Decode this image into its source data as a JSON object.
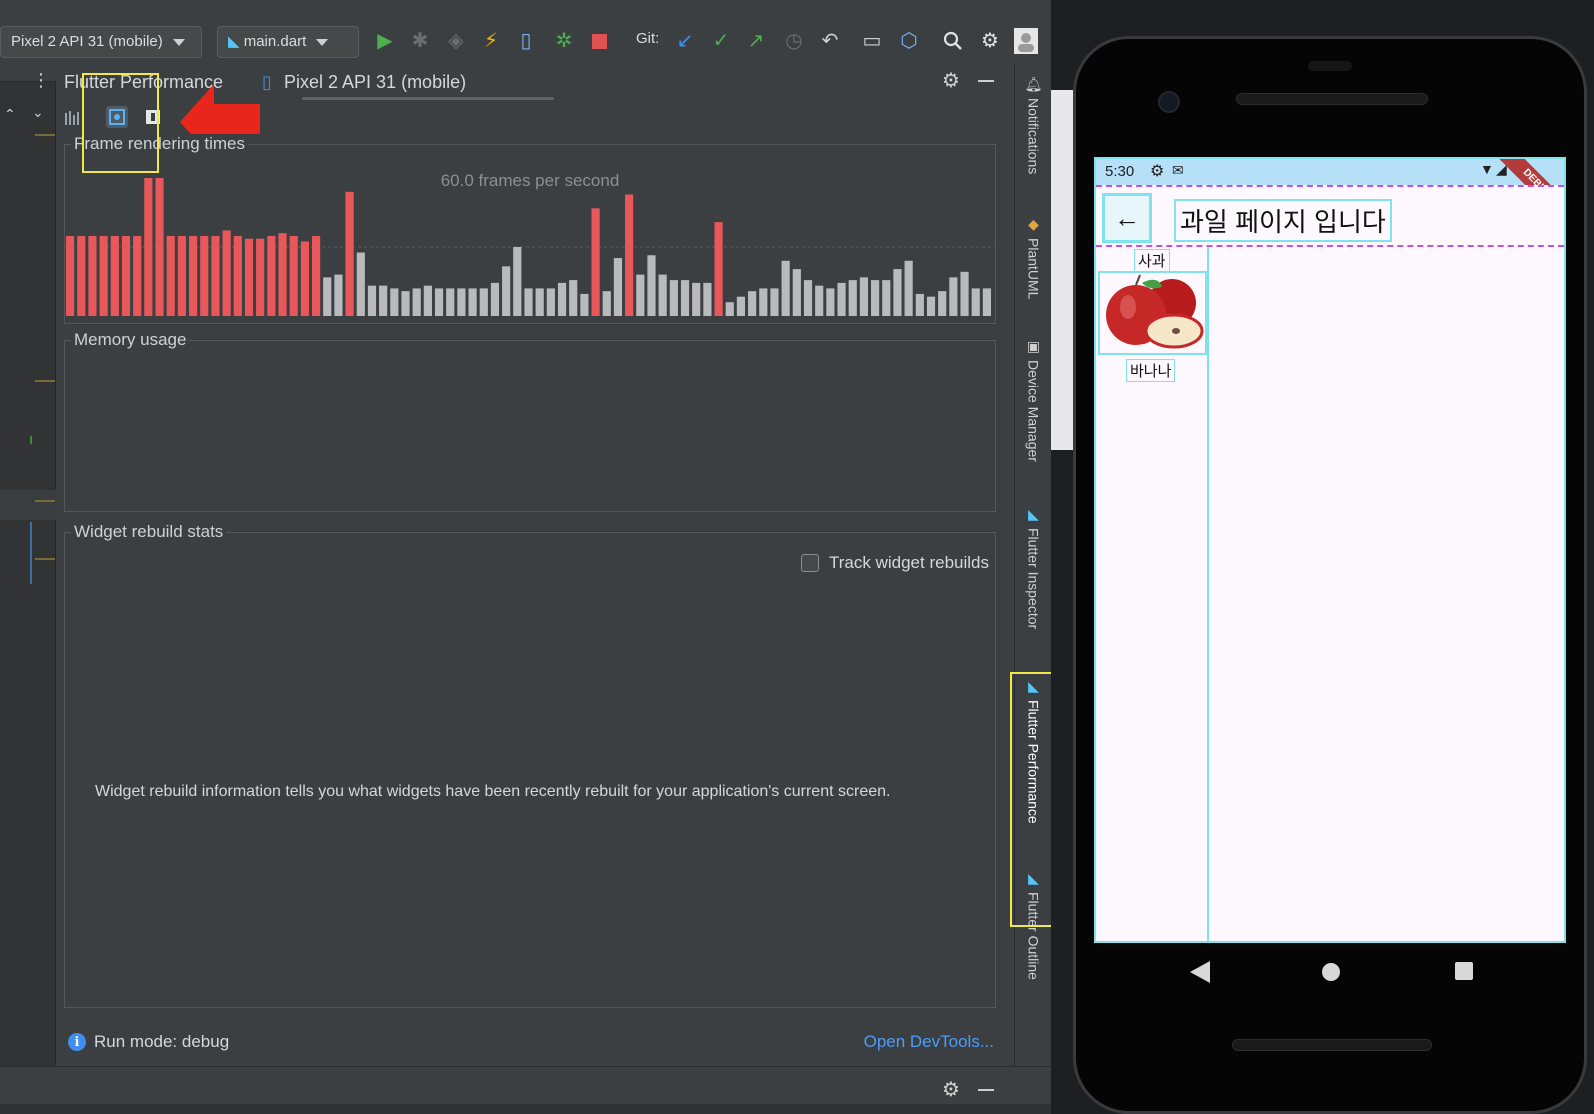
{
  "toolbar": {
    "device_selector": "Pixel 2 API 31 (mobile)",
    "run_config": "main.dart",
    "git_label": "Git:"
  },
  "tool_window": {
    "tabs": [
      {
        "label": "Flutter Performance"
      },
      {
        "label": "Pixel 2 API 31 (mobile)"
      }
    ]
  },
  "frame_rendering": {
    "title": "Frame rendering times",
    "fps_label": "60.0 frames per second",
    "chart_data": {
      "type": "bar",
      "title": "Frame rendering times",
      "subtitle": "60.0 frames per second",
      "series": [
        {
          "values": [
            0.58,
            0.58,
            0.58,
            0.58,
            0.58,
            0.58,
            0.58,
            1.0,
            1.0,
            0.58,
            0.58,
            0.58,
            0.58,
            0.58,
            0.62,
            0.58,
            0.56,
            0.56,
            0.58,
            0.6,
            0.58,
            0.54,
            0.58,
            0.28,
            0.3,
            0.9,
            0.46,
            0.22,
            0.22,
            0.2,
            0.18,
            0.2,
            0.22,
            0.2,
            0.2,
            0.2,
            0.2,
            0.2,
            0.24,
            0.36,
            0.5,
            0.2,
            0.2,
            0.2,
            0.24,
            0.26,
            0.16,
            0.78,
            0.18,
            0.42,
            0.88,
            0.3,
            0.44,
            0.3,
            0.26,
            0.26,
            0.24,
            0.24,
            0.68,
            0.1,
            0.14,
            0.18,
            0.2,
            0.2,
            0.4,
            0.34,
            0.26,
            0.22,
            0.2,
            0.24,
            0.26,
            0.28,
            0.26,
            0.26,
            0.34,
            0.4,
            0.16,
            0.14,
            0.18,
            0.28,
            0.32,
            0.2,
            0.2
          ],
          "janky": [
            true,
            true,
            true,
            true,
            true,
            true,
            true,
            true,
            true,
            true,
            true,
            true,
            true,
            true,
            true,
            true,
            true,
            true,
            true,
            true,
            true,
            true,
            true,
            false,
            false,
            true,
            false,
            false,
            false,
            false,
            false,
            false,
            false,
            false,
            false,
            false,
            false,
            false,
            false,
            false,
            false,
            false,
            false,
            false,
            false,
            false,
            false,
            true,
            false,
            false,
            true,
            false,
            false,
            false,
            false,
            false,
            false,
            false,
            true,
            false,
            false,
            false,
            false,
            false,
            false,
            false,
            false,
            false,
            false,
            false,
            false,
            false,
            false,
            false,
            false,
            false,
            false,
            false,
            false,
            false,
            false,
            false,
            false
          ]
        }
      ],
      "colors": {
        "janky": "#e8585a",
        "normal": "#b8babd"
      },
      "grid": false
    }
  },
  "memory_usage": {
    "title": "Memory usage"
  },
  "widget_rebuild": {
    "title": "Widget rebuild stats",
    "track_label": "Track widget rebuilds",
    "info": "Widget rebuild information tells you what widgets have been recently rebuilt for your application's current screen."
  },
  "status": {
    "run_mode": "Run mode: debug",
    "devtools_link": "Open DevTools..."
  },
  "side_strip": {
    "items": [
      {
        "label": "Notifications"
      },
      {
        "label": "PlantUML"
      },
      {
        "label": "Device Manager"
      },
      {
        "label": "Flutter Inspector"
      },
      {
        "label": "Flutter Performance"
      },
      {
        "label": "Flutter Outline"
      }
    ]
  },
  "emulator": {
    "time": "5:30",
    "app_title": "과일 페이지 입니다",
    "fruits": [
      {
        "label": "사과"
      },
      {
        "label": "바나나"
      }
    ],
    "debug_banner": "DEBUG"
  },
  "colors": {
    "accent_blue": "#3d8ef0",
    "highlight_yellow": "#f2e84a",
    "arrow_red": "#e8261c",
    "run_green": "#4caf50",
    "stop_red": "#e05252"
  }
}
